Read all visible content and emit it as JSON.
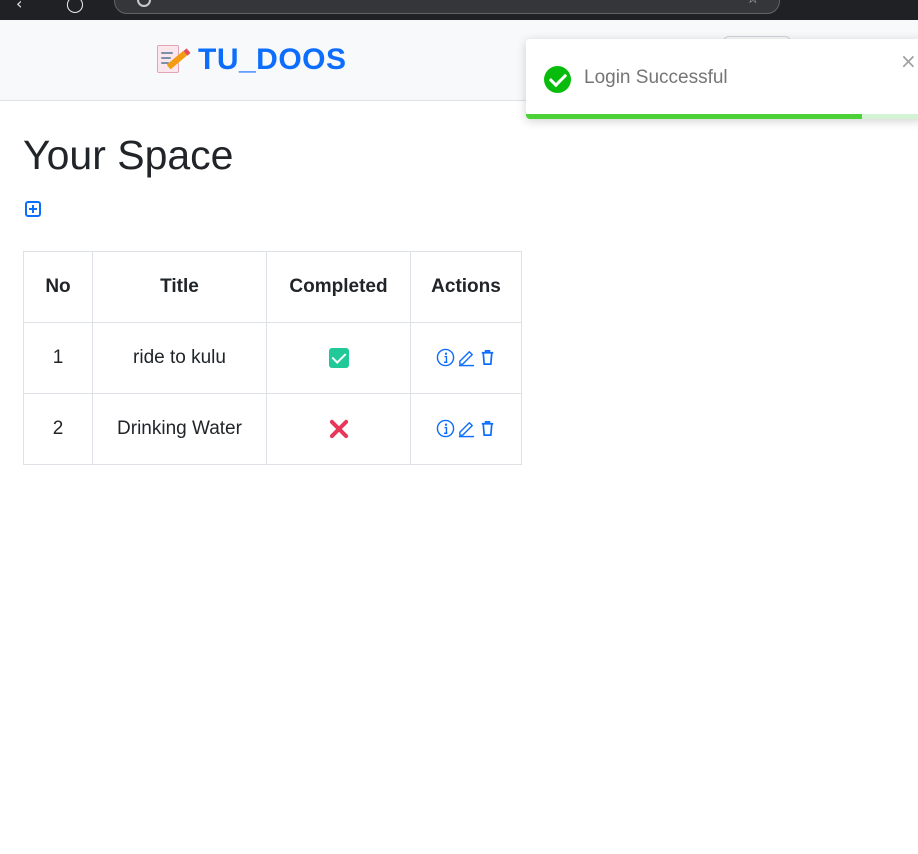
{
  "navbar": {
    "brand_title": "TU_DOOS"
  },
  "page": {
    "title": "Your Space"
  },
  "table": {
    "headers": [
      "No",
      "Title",
      "Completed",
      "Actions"
    ],
    "rows": [
      {
        "no": "1",
        "title": "ride to kulu",
        "completed": true
      },
      {
        "no": "2",
        "title": "Drinking Water",
        "completed": false
      }
    ]
  },
  "toast": {
    "message": "Login Successful",
    "close_glyph": "×",
    "progress": 0.84
  },
  "colors": {
    "primary": "#0d6efd",
    "success": "#20c997",
    "danger": "#e8385a",
    "toast_icon": "#07bc0c",
    "toast_progress": "#4cd137"
  },
  "icons": [
    "plus-square-icon",
    "info-circle-icon",
    "pencil-icon",
    "trash-icon",
    "check-square-icon",
    "x-mark-icon",
    "success-check-icon",
    "close-icon"
  ]
}
